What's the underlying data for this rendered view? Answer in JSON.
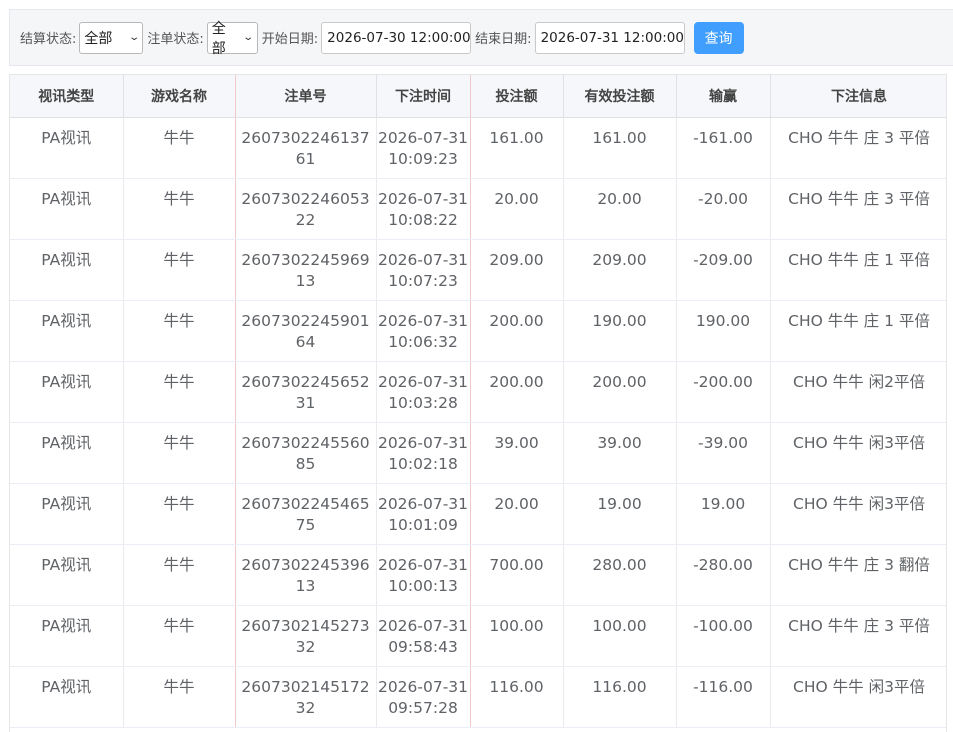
{
  "filters": {
    "settle_label": "结算状态:",
    "settle_value": "全部",
    "order_label": "注单状态:",
    "order_value": "全部",
    "start_label": "开始日期:",
    "start_value": "2026-07-30 12:00:00",
    "end_label": "结束日期:",
    "end_value": "2026-07-31 12:00:00",
    "query_button": "查询"
  },
  "table": {
    "columns": [
      "视讯类型",
      "游戏名称",
      "注单号",
      "下注时间",
      "投注额",
      "有效投注额",
      "输赢",
      "下注信息"
    ],
    "rows": [
      [
        "PA视讯",
        "牛牛",
        "260730224613761",
        "2026-07-31 10:09:23",
        "161.00",
        "161.00",
        "-161.00",
        "CHO 牛牛 庄 3 平倍"
      ],
      [
        "PA视讯",
        "牛牛",
        "260730224605322",
        "2026-07-31 10:08:22",
        "20.00",
        "20.00",
        "-20.00",
        "CHO 牛牛 庄 3 平倍"
      ],
      [
        "PA视讯",
        "牛牛",
        "260730224596913",
        "2026-07-31 10:07:23",
        "209.00",
        "209.00",
        "-209.00",
        "CHO 牛牛 庄 1 平倍"
      ],
      [
        "PA视讯",
        "牛牛",
        "260730224590164",
        "2026-07-31 10:06:32",
        "200.00",
        "190.00",
        "190.00",
        "CHO 牛牛 庄 1 平倍"
      ],
      [
        "PA视讯",
        "牛牛",
        "260730224565231",
        "2026-07-31 10:03:28",
        "200.00",
        "200.00",
        "-200.00",
        "CHO 牛牛 闲2平倍"
      ],
      [
        "PA视讯",
        "牛牛",
        "260730224556085",
        "2026-07-31 10:02:18",
        "39.00",
        "39.00",
        "-39.00",
        "CHO 牛牛 闲3平倍"
      ],
      [
        "PA视讯",
        "牛牛",
        "260730224546575",
        "2026-07-31 10:01:09",
        "20.00",
        "19.00",
        "19.00",
        "CHO 牛牛 闲3平倍"
      ],
      [
        "PA视讯",
        "牛牛",
        "260730224539613",
        "2026-07-31 10:00:13",
        "700.00",
        "280.00",
        "-280.00",
        "CHO 牛牛 庄 3 翻倍"
      ],
      [
        "PA视讯",
        "牛牛",
        "260730214527332",
        "2026-07-31 09:58:43",
        "100.00",
        "100.00",
        "-100.00",
        "CHO 牛牛 庄 3 平倍"
      ],
      [
        "PA视讯",
        "牛牛",
        "260730214517232",
        "2026-07-31 09:57:28",
        "116.00",
        "116.00",
        "-116.00",
        "CHO 牛牛 闲3平倍"
      ]
    ]
  }
}
